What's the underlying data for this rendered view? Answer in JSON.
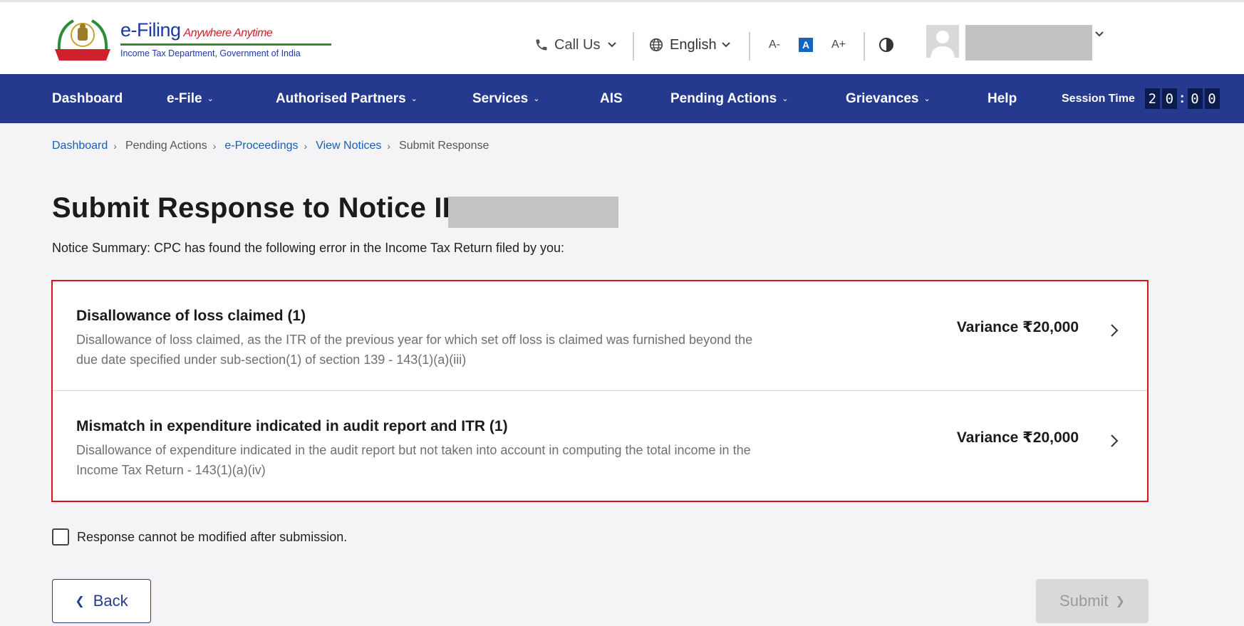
{
  "header": {
    "logo_title": "e-Filing",
    "logo_tagline": "Anywhere Anytime",
    "logo_subtitle": "Income Tax Department, Government of India",
    "emblem_text": "INCOME TAX DEPARTMENT",
    "call_us": "Call Us",
    "language": "English",
    "font_decrease": "A-",
    "font_default": "A",
    "font_increase": "A+"
  },
  "nav": {
    "items": [
      {
        "label": "Dashboard",
        "has_dropdown": false
      },
      {
        "label": "e-File",
        "has_dropdown": true
      },
      {
        "label": "Authorised Partners",
        "has_dropdown": true
      },
      {
        "label": "Services",
        "has_dropdown": true
      },
      {
        "label": "AIS",
        "has_dropdown": false
      },
      {
        "label": "Pending Actions",
        "has_dropdown": true
      },
      {
        "label": "Grievances",
        "has_dropdown": true
      },
      {
        "label": "Help",
        "has_dropdown": false
      }
    ],
    "session_label": "Session Time",
    "session_digits": [
      "2",
      "0",
      "0",
      "0"
    ]
  },
  "breadcrumb": [
    {
      "label": "Dashboard",
      "link": true
    },
    {
      "label": "Pending Actions",
      "link": false
    },
    {
      "label": "e-Proceedings",
      "link": true
    },
    {
      "label": "View Notices",
      "link": true
    },
    {
      "label": "Submit Response",
      "link": false
    }
  ],
  "page": {
    "title": "Submit Response to Notice ID",
    "summary": "Notice Summary: CPC has found the following error in the Income Tax Return filed by you:"
  },
  "errors": [
    {
      "title": "Disallowance of loss claimed (1)",
      "description": "Disallowance of loss claimed, as the ITR of the previous year for which set off loss is claimed was furnished beyond the due date specified under sub-section(1) of section 139 - 143(1)(a)(iii)",
      "variance": "Variance ₹20,000"
    },
    {
      "title": "Mismatch in expenditure indicated in audit report and ITR (1)",
      "description": "Disallowance of expenditure indicated in the audit report but not taken into account in computing the total income in the Income Tax Return - 143(1)(a)(iv)",
      "variance": "Variance ₹20,000"
    }
  ],
  "acknowledgement": {
    "label": "Response cannot be modified after submission.",
    "checked": false
  },
  "actions": {
    "back_label": "Back",
    "submit_label": "Submit"
  },
  "colors": {
    "nav_bg": "#25398f",
    "highlight_border": "#e0111b",
    "link": "#1a5fb4"
  }
}
